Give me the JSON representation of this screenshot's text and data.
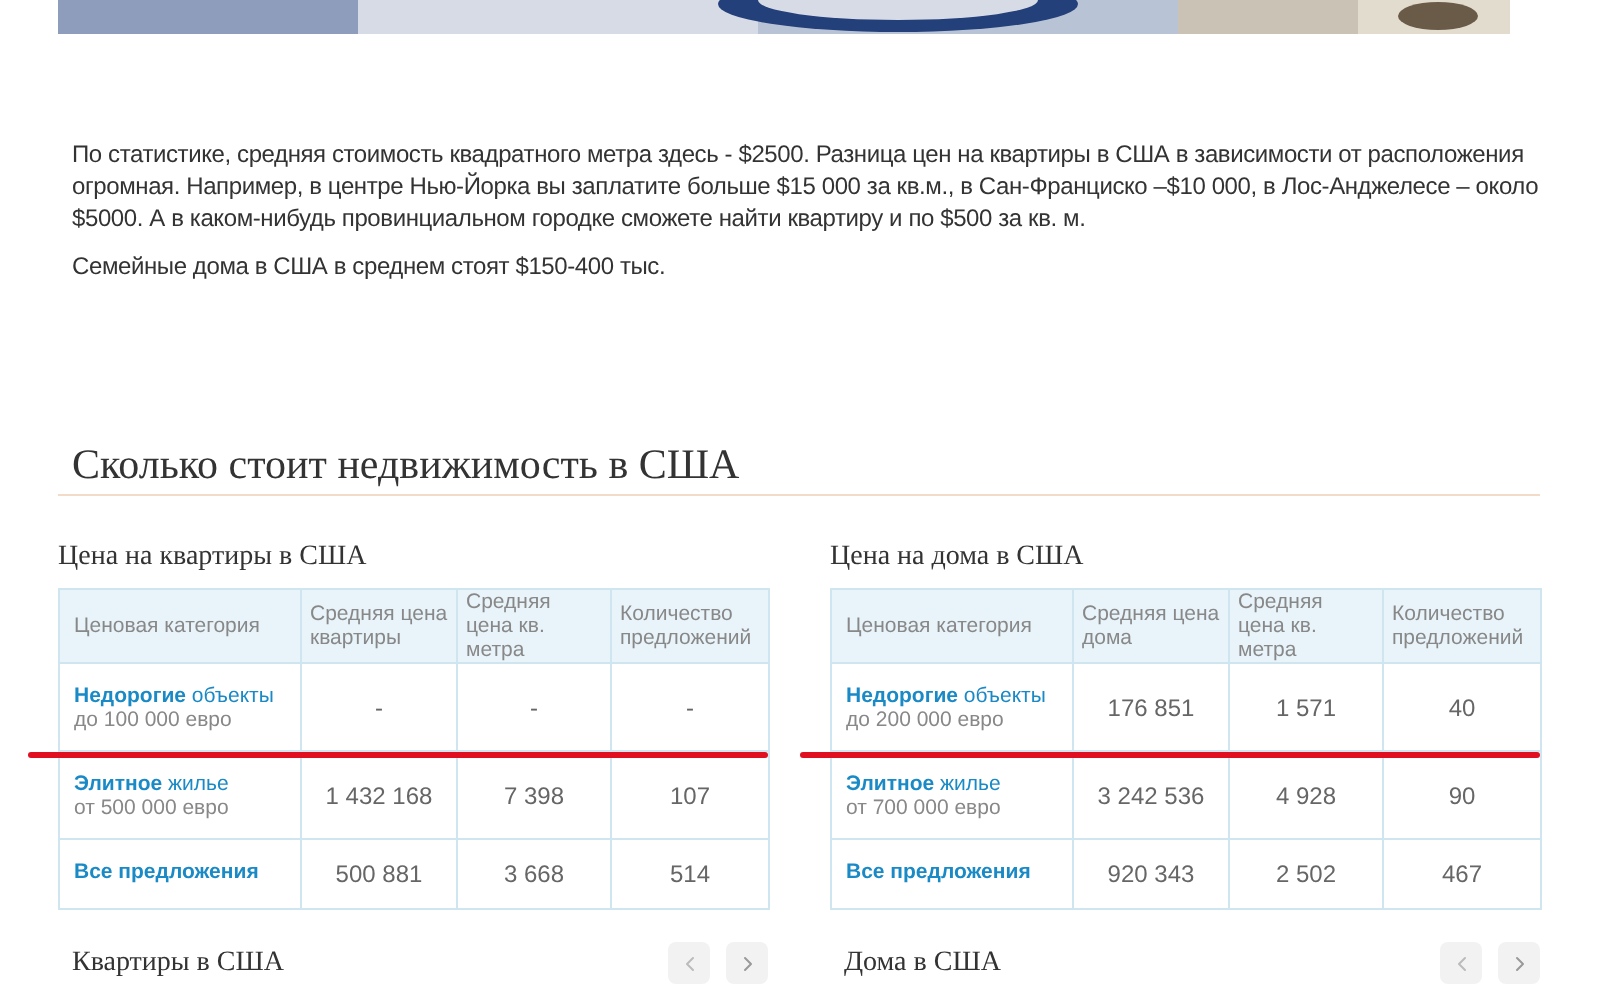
{
  "hero": {
    "kind": "picture"
  },
  "paragraphs": [
    "По статистике, средняя стоимость квадратного метра здесь - $2500. Разница цен на квартиры в США в зависимости от расположения огромная. Например, в центре Нью-Йорка вы заплатите больше $15 000 за кв.м., в Сан-Франциско –$10 000, в Лос-Анджелесе – около $5000. А в каком-нибудь провинциальном городке сможете найти квартиру и по $500 за кв. м.",
    "Семейные дома в США в среднем стоят $150-400 тыс."
  ],
  "section_title": "Сколько стоит недвижимость в США",
  "tables": [
    {
      "title": "Цена на квартиры в США",
      "category_header": "Ценовая категория",
      "columns": [
        "Средняя цена квартиры",
        "Средняя цена кв. метра",
        "Количество предложений"
      ],
      "rows": [
        {
          "kind": "category",
          "label": "**Недорогие** объекты",
          "note": "до 100 000 евро",
          "cells": [
            "-",
            "-",
            "-"
          ],
          "underlined": true
        },
        {
          "kind": "category",
          "label": "**Элитное** жилье",
          "note": "от 500 000 евро",
          "cells": [
            "1 432 168",
            "7 398",
            "107"
          ],
          "underlined": false
        },
        {
          "kind": "total",
          "label": "Все предложения",
          "cells": [
            "500 881",
            "3 668",
            "514"
          ],
          "underlined": false
        }
      ]
    },
    {
      "title": "Цена на дома в США",
      "category_header": "Ценовая категория",
      "columns": [
        "Средняя цена дома",
        "Средняя цена кв. метра",
        "Количество предложений"
      ],
      "rows": [
        {
          "kind": "category",
          "label": "**Недорогие** объекты",
          "note": "до 200 000 евро",
          "cells": [
            "176 851",
            "1 571",
            "40"
          ],
          "underlined": true
        },
        {
          "kind": "category",
          "label": "**Элитное** жилье",
          "note": "от 700 000 евро",
          "cells": [
            "3 242 536",
            "4 928",
            "90"
          ],
          "underlined": false
        },
        {
          "kind": "total",
          "label": "Все предложения",
          "cells": [
            "920 343",
            "2 502",
            "467"
          ],
          "underlined": false
        }
      ]
    }
  ],
  "carousels": [
    {
      "title": "Квартиры в США"
    },
    {
      "title": "Дома в США"
    }
  ]
}
